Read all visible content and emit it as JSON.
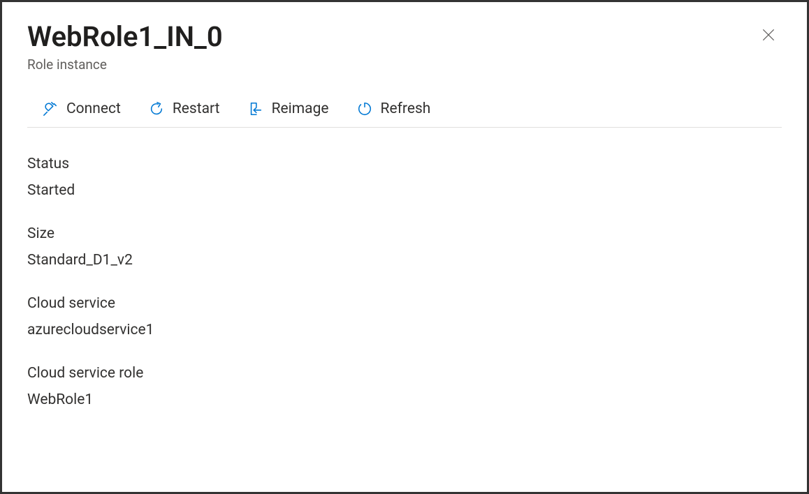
{
  "header": {
    "title": "WebRole1_IN_0",
    "subtitle": "Role instance"
  },
  "toolbar": {
    "connect_label": "Connect",
    "restart_label": "Restart",
    "reimage_label": "Reimage",
    "refresh_label": "Refresh"
  },
  "details": {
    "status_label": "Status",
    "status_value": "Started",
    "size_label": "Size",
    "size_value": "Standard_D1_v2",
    "cloud_service_label": "Cloud service",
    "cloud_service_value": "azurecloudservice1",
    "cloud_service_role_label": "Cloud service role",
    "cloud_service_role_value": "WebRole1"
  }
}
